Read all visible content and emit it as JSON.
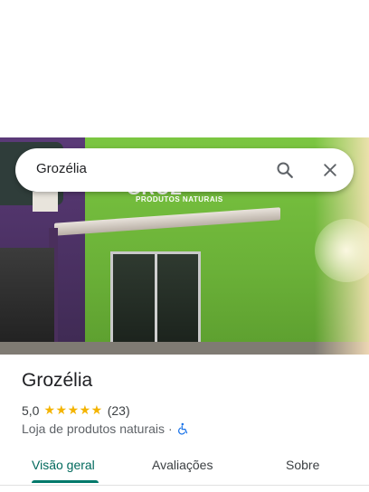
{
  "search": {
    "query": "Grozélia"
  },
  "place": {
    "name": "Grozélia",
    "rating": "5,0",
    "stars": "★★★★★",
    "reviews_count": "(23)",
    "category": "Loja de produtos naturais",
    "separator": "·"
  },
  "photo": {
    "sign_text": "GROZ",
    "sign_subtext": "PRODUTOS NATURAIS",
    "small_sign": "DELIVERY (49) 3XXX-XXXX"
  },
  "tabs": [
    {
      "label": "Visão geral",
      "active": true
    },
    {
      "label": "Avaliações",
      "active": false
    },
    {
      "label": "Sobre",
      "active": false
    }
  ],
  "colors": {
    "accent": "#00796b",
    "star": "#f4b400",
    "accessibility": "#1a73e8"
  },
  "icons": {
    "search": "search-icon",
    "close": "close-icon",
    "accessibility": "wheelchair-icon"
  }
}
